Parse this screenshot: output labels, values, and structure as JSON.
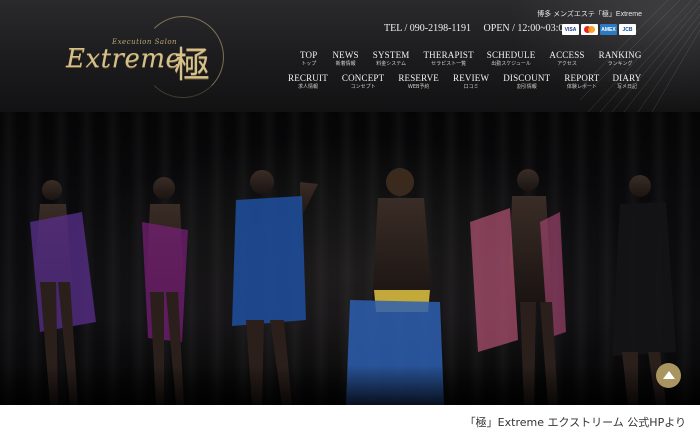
{
  "brand": {
    "logo_word": "Extreme",
    "logo_kanji": "極",
    "logo_sub": "Execution Salon"
  },
  "topline": "博多 メンズエステ「極」Extreme",
  "contact": {
    "tel": "TEL / 090-2198-1191",
    "open": "OPEN / 12:00~03:00"
  },
  "cards": [
    "VISA",
    "MasterCard",
    "AMEX",
    "JCB"
  ],
  "nav": {
    "row1": [
      {
        "en": "TOP",
        "jp": "トップ"
      },
      {
        "en": "NEWS",
        "jp": "新着情報"
      },
      {
        "en": "SYSTEM",
        "jp": "料金システム"
      },
      {
        "en": "THERAPIST",
        "jp": "セラピスト一覧"
      },
      {
        "en": "SCHEDULE",
        "jp": "出勤スケジュール"
      },
      {
        "en": "ACCESS",
        "jp": "アクセス"
      },
      {
        "en": "RANKING",
        "jp": "ランキング"
      }
    ],
    "row2": [
      {
        "en": "RECRUIT",
        "jp": "求人情報"
      },
      {
        "en": "CONCEPT",
        "jp": "コンセプト"
      },
      {
        "en": "RESERVE",
        "jp": "WEB予約"
      },
      {
        "en": "REVIEW",
        "jp": "口コミ"
      },
      {
        "en": "DISCOUNT",
        "jp": "割引情報"
      },
      {
        "en": "REPORT",
        "jp": "体験レポート"
      },
      {
        "en": "DIARY",
        "jp": "写メ日記"
      }
    ]
  },
  "colors": {
    "gold": "#d6c08a",
    "scroll_button": "#a8955f",
    "header_bg": "#1b1b1d"
  },
  "caption": "「極」Extreme エクストリーム 公式HPより"
}
